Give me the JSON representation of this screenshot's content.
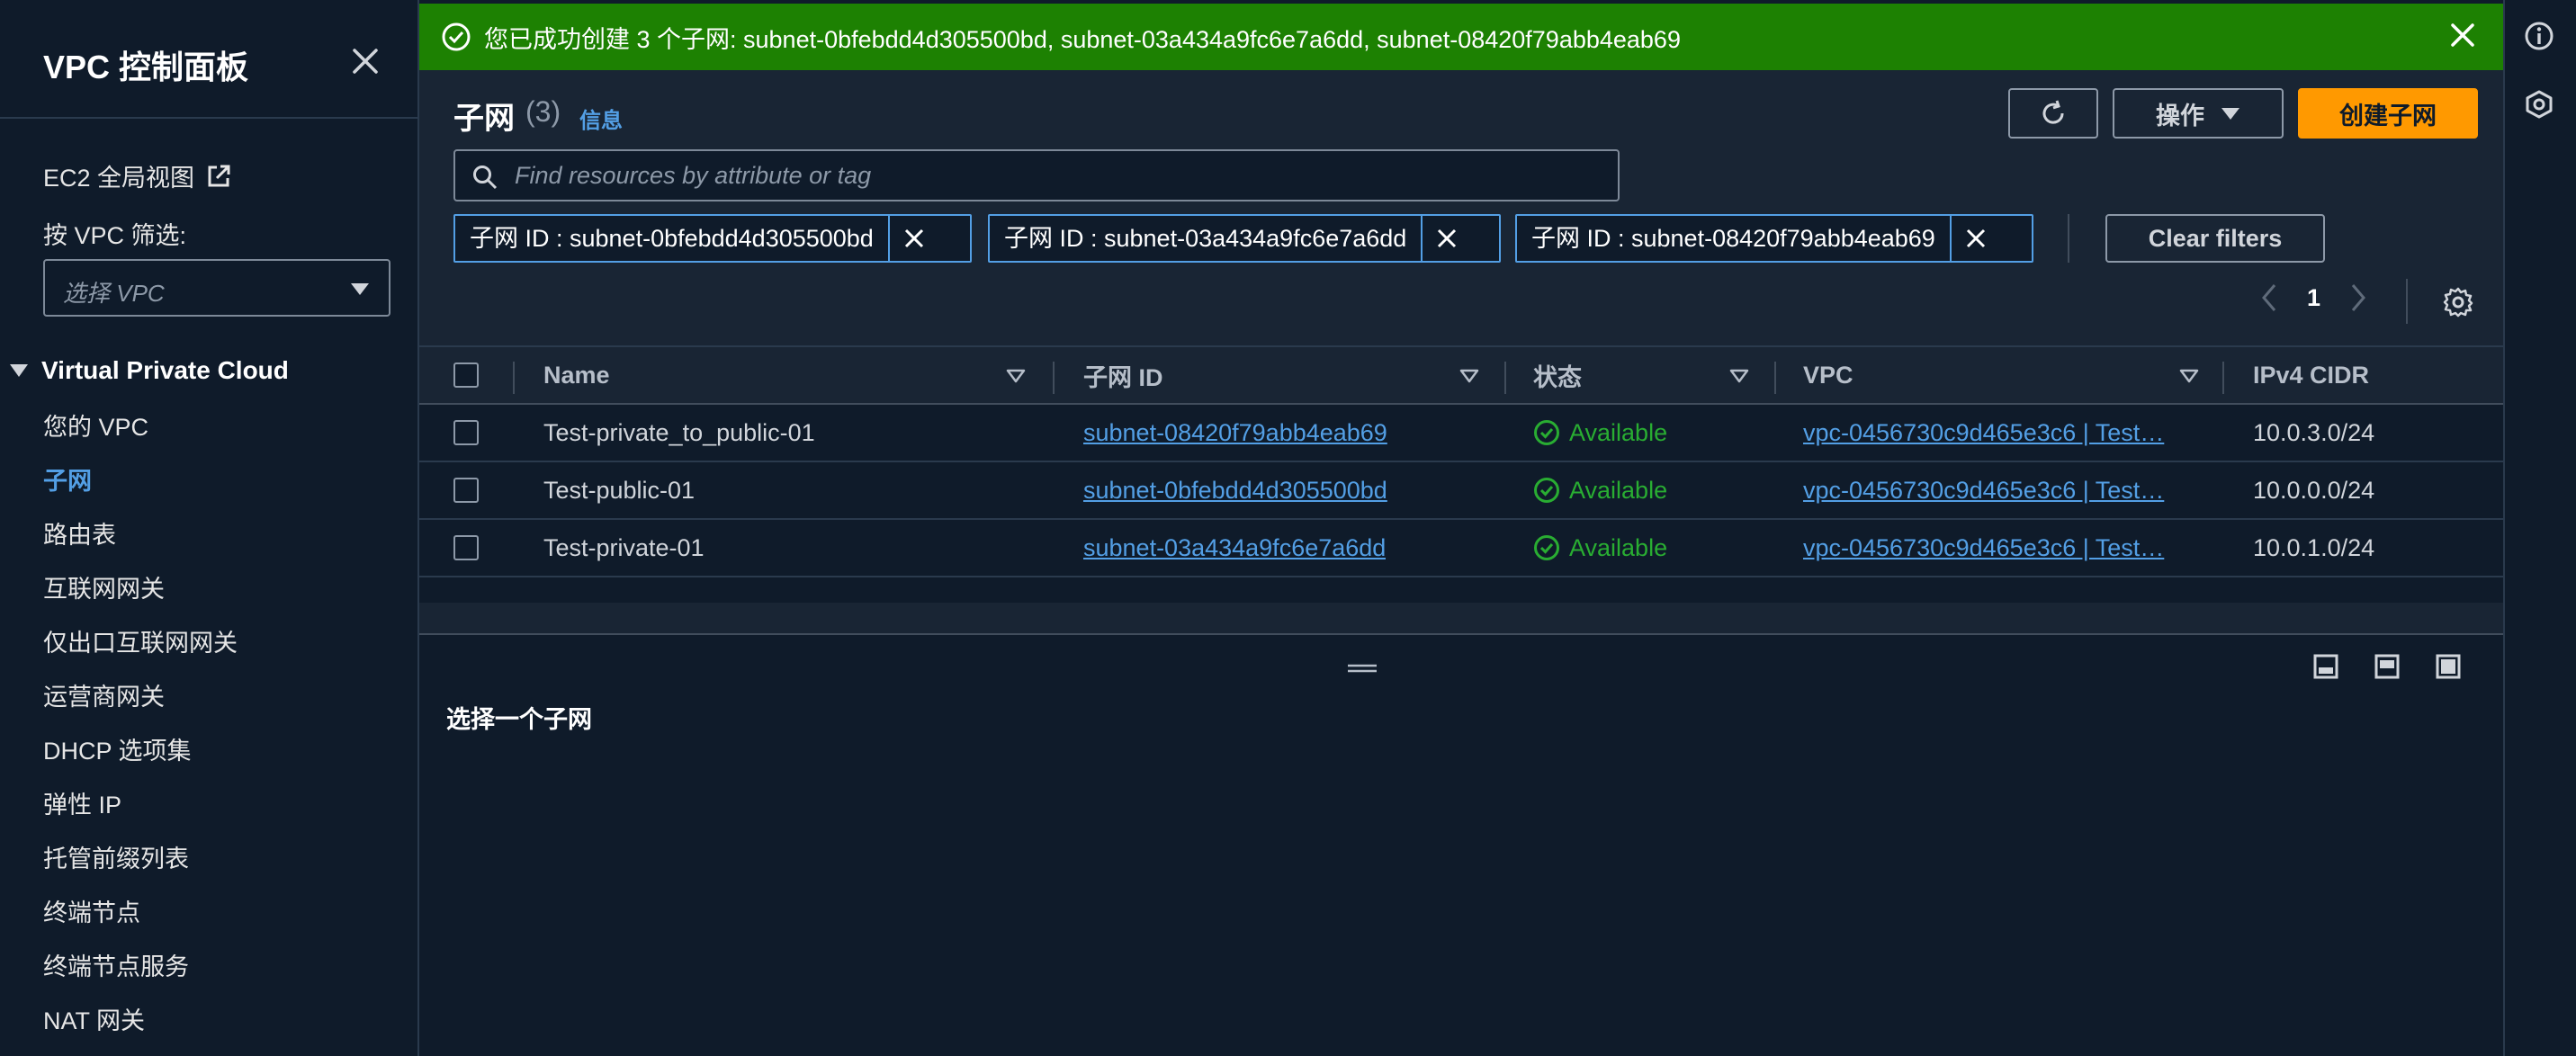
{
  "sidebar": {
    "title": "VPC 控制面板",
    "ec2_global_view": "EC2 全局视图",
    "filter_label": "按 VPC 筛选:",
    "filter_placeholder": "选择 VPC",
    "section_title": "Virtual Private Cloud",
    "nav_items": [
      {
        "label": "您的 VPC"
      },
      {
        "label": "子网"
      },
      {
        "label": "路由表"
      },
      {
        "label": "互联网网关"
      },
      {
        "label": "仅出口互联网网关"
      },
      {
        "label": "运营商网关"
      },
      {
        "label": "DHCP 选项集"
      },
      {
        "label": "弹性 IP"
      },
      {
        "label": "托管前缀列表"
      },
      {
        "label": "终端节点"
      },
      {
        "label": "终端节点服务"
      },
      {
        "label": "NAT 网关"
      }
    ],
    "active_item": "子网"
  },
  "banner": {
    "message": "您已成功创建 3 个子网: subnet-0bfebdd4d305500bd, subnet-03a434a9fc6e7a6dd, subnet-08420f79abb4eab69",
    "color": "#1d8102"
  },
  "header": {
    "title": "子网",
    "count": "(3)",
    "info": "信息",
    "actions_label": "操作",
    "create_label": "创建子网"
  },
  "search": {
    "placeholder": "Find resources by attribute or tag"
  },
  "filters": [
    {
      "label": "子网 ID : subnet-0bfebdd4d305500bd"
    },
    {
      "label": "子网 ID : subnet-03a434a9fc6e7a6dd"
    },
    {
      "label": "子网 ID : subnet-08420f79abb4eab69"
    }
  ],
  "clear_filters": "Clear filters",
  "pagination": {
    "page": "1"
  },
  "table": {
    "columns": [
      "Name",
      "子网 ID",
      "状态",
      "VPC",
      "IPv4 CIDR"
    ],
    "rows": [
      {
        "name": "Test-private_to_public-01",
        "subnet_id": "subnet-08420f79abb4eab69",
        "status": "Available",
        "vpc": "vpc-0456730c9d465e3c6 | Test…",
        "cidr": "10.0.3.0/24"
      },
      {
        "name": "Test-public-01",
        "subnet_id": "subnet-0bfebdd4d305500bd",
        "status": "Available",
        "vpc": "vpc-0456730c9d465e3c6 | Test…",
        "cidr": "10.0.0.0/24"
      },
      {
        "name": "Test-private-01",
        "subnet_id": "subnet-03a434a9fc6e7a6dd",
        "status": "Available",
        "vpc": "vpc-0456730c9d465e3c6 | Test…",
        "cidr": "10.0.1.0/24"
      }
    ]
  },
  "detail": {
    "title": "选择一个子网"
  },
  "colors": {
    "accent": "#ff9900",
    "link": "#539fe5",
    "success": "#29ad32"
  }
}
